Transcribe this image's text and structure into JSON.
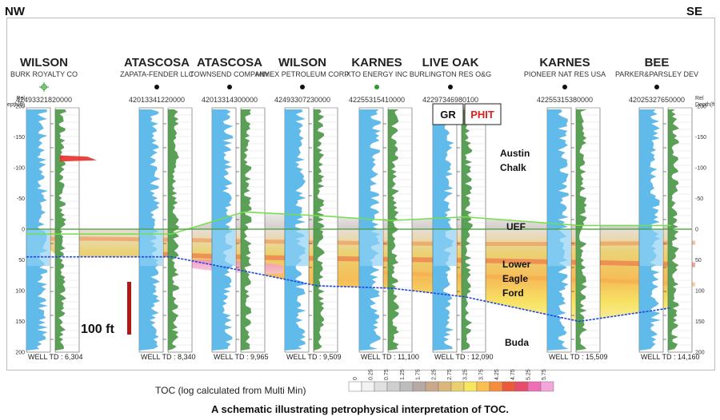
{
  "header": {
    "left": "NW",
    "right": "SE"
  },
  "depth_axis": {
    "label_lines": [
      "Rel",
      "Depth(ft)"
    ],
    "ticks": [
      -200,
      -150,
      -100,
      -50,
      0,
      50,
      100,
      150,
      200
    ]
  },
  "wells": [
    {
      "name": "WILSON",
      "operator": "BURK ROYALTY CO",
      "api": "42493321820000",
      "td": "WELL TD : 6,304",
      "symbol": "star"
    },
    {
      "name": "ATASCOSA",
      "operator": "ZAPATA-FENDER LLC",
      "api": "42013341220000",
      "td": "WELL TD : 8,340",
      "symbol": "dot"
    },
    {
      "name": "ATASCOSA",
      "operator": "TOWNSEND COMPANY",
      "api": "42013314300000",
      "td": "WELL TD : 9,965",
      "symbol": "dot"
    },
    {
      "name": "WILSON",
      "operator": "MIMEX PETROLEUM CORP",
      "api": "42493307230000",
      "td": "WELL TD : 9,509",
      "symbol": "dot"
    },
    {
      "name": "KARNES",
      "operator": "XTO ENERGY INC",
      "api": "42255315410000",
      "td": "WELL TD : 11,100",
      "symbol": "green-dot"
    },
    {
      "name": "LIVE OAK",
      "operator": "BURLINGTON RES O&G",
      "api": "42297346980100",
      "td": "WELL TD : 12,090",
      "symbol": "dot"
    },
    {
      "name": "KARNES",
      "operator": "PIONEER NAT RES USA",
      "api": "42255315380000",
      "td": "WELL TD : 15,509",
      "symbol": "dot"
    },
    {
      "name": "BEE",
      "operator": "PARKER&PARSLEY DEV",
      "api": "42025327650000",
      "td": "WELL TD : 14,160",
      "symbol": "dot"
    }
  ],
  "track_labels": {
    "gr": "GR",
    "phit": "PHIT"
  },
  "zones": {
    "austin_line1": "Austin",
    "austin_line2": "Chalk",
    "uef": "UEF",
    "lef_line1": "Lower",
    "lef_line2": "Eagle",
    "lef_line3": "Ford",
    "buda": "Buda"
  },
  "scale_bar": {
    "label": "100 ft"
  },
  "legend": {
    "title": "TOC (log calculated from Multi Min)",
    "ticks": [
      "0",
      "0.25",
      "0.75",
      "1.25",
      "1.75",
      "2.25",
      "2.75",
      "3.25",
      "3.75",
      "4.25",
      "4.75",
      "5.25",
      "5.75"
    ],
    "colors": [
      "#ffffff",
      "#f2f2f2",
      "#e0e0e0",
      "#cfcfcf",
      "#bfbcbc",
      "#b7a9a4",
      "#c9a88c",
      "#dcb77a",
      "#ead06d",
      "#f7e760",
      "#f9c04f",
      "#f58d3c",
      "#ec5a3c",
      "#e94c6a",
      "#ee6fb5",
      "#f4a6dc"
    ]
  },
  "caption": "A schematic illustrating petrophysical interpretation of TOC.",
  "colors": {
    "gr_fill": "#4fb3e8",
    "gr_fill_light": "#8fd2f3",
    "res_fill": "#3e8f3a",
    "top_line": "#72e04a",
    "base_line": "#2045e0",
    "scale_bar": "#b01818"
  }
}
